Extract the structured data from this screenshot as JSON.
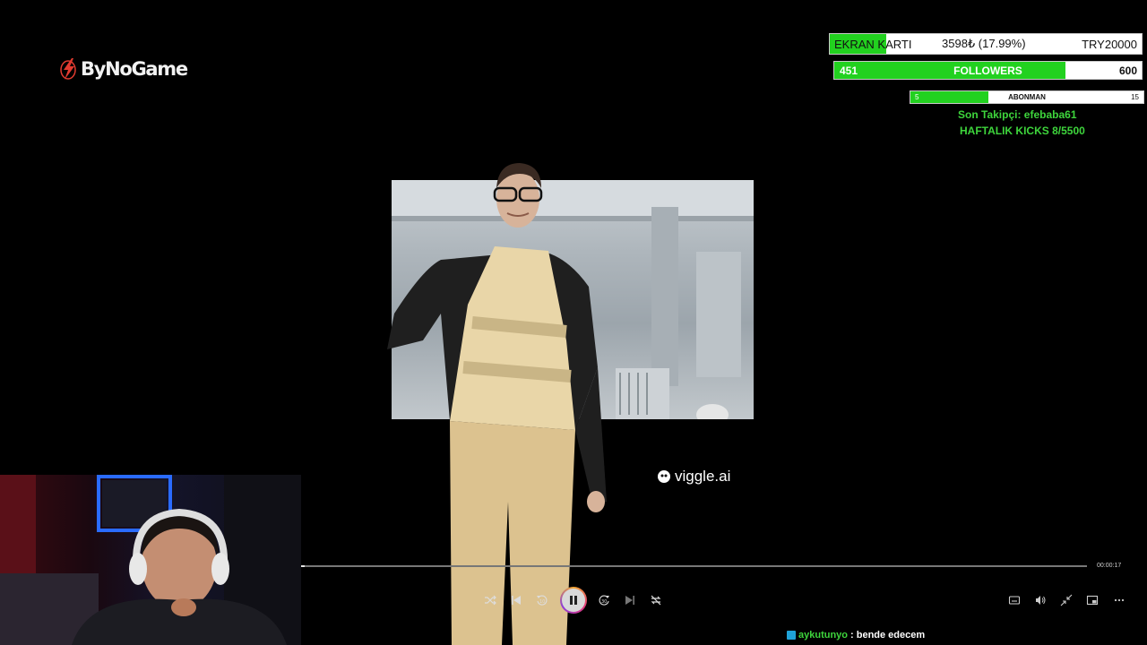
{
  "logo": {
    "text": "ByNoGame",
    "icon": "bynogame-logo-mark"
  },
  "overlay": {
    "ekran_karti": {
      "label": "EKRAN KARTI",
      "value": "3598₺ (17.99%)",
      "target": "TRY20000",
      "progress": 0.1799
    },
    "followers": {
      "current": "451",
      "label": "FOLLOWERS",
      "target": "600",
      "progress": 0.7517
    },
    "abonman": {
      "current": "5",
      "label": "ABONMAN",
      "target": "15",
      "progress": 0.3333
    },
    "last_follower": "Son Takipçi: efebaba61",
    "weekly_kicks": "HAFTALIK KICKS 8/5500"
  },
  "video": {
    "watermark": "viggle.ai"
  },
  "player": {
    "elapsed": "00:00:17",
    "progress": 0.005,
    "controls": [
      "shuffle-icon",
      "skip-previous-icon",
      "rewind-10-icon",
      "pause-icon",
      "forward-30-icon",
      "skip-next-icon",
      "repeat-off-icon"
    ],
    "right_controls": [
      "subtitles-icon",
      "volume-icon",
      "exit-fullscreen-icon",
      "picture-in-picture-icon",
      "more-icon"
    ]
  },
  "chat": {
    "user": "aykutunyo",
    "message": ": bende edecem"
  },
  "colors": {
    "accent_green": "#22d11f",
    "text_green": "#3ed53c",
    "background": "#000000"
  }
}
